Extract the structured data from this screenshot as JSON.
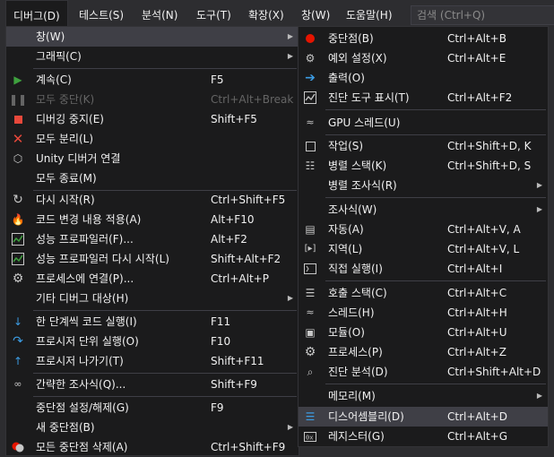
{
  "menubar": {
    "items": [
      "디버그(D)",
      "테스트(S)",
      "분석(N)",
      "도구(T)",
      "확장(X)",
      "창(W)",
      "도움말(H)"
    ],
    "search_placeholder": "검색 (Ctrl+Q)"
  },
  "main_menu": {
    "items": [
      {
        "label": "창(W)",
        "shortcut": "",
        "icon": "none"
      },
      {
        "label": "그래픽(C)",
        "shortcut": "",
        "icon": "none"
      },
      {
        "label": "계속(C)",
        "shortcut": "F5",
        "icon": "play-icon"
      },
      {
        "label": "모두 중단(K)",
        "shortcut": "Ctrl+Alt+Break",
        "icon": "pause-icon"
      },
      {
        "label": "디버깅 중지(E)",
        "shortcut": "Shift+F5",
        "icon": "stop-icon"
      },
      {
        "label": "모두 분리(L)",
        "shortcut": "",
        "icon": "detach-icon"
      },
      {
        "label": "Unity 디버거 연결",
        "shortcut": "",
        "icon": "unity-icon"
      },
      {
        "label": "모두 종료(M)",
        "shortcut": "",
        "icon": "none"
      },
      {
        "label": "다시 시작(R)",
        "shortcut": "Ctrl+Shift+F5",
        "icon": "restart-icon"
      },
      {
        "label": "코드 변경 내용 적용(A)",
        "shortcut": "Alt+F10",
        "icon": "hot-reload-icon"
      },
      {
        "label": "성능 프로파일러(F)...",
        "shortcut": "Alt+F2",
        "icon": "profiler-icon"
      },
      {
        "label": "성능 프로파일러 다시 시작(L)",
        "shortcut": "Shift+Alt+F2",
        "icon": "profiler-restart-icon"
      },
      {
        "label": "프로세스에 연결(P)...",
        "shortcut": "Ctrl+Alt+P",
        "icon": "attach-process-icon"
      },
      {
        "label": "기타 디버그 대상(H)",
        "shortcut": "",
        "icon": "none"
      },
      {
        "label": "한 단계씩 코드 실행(I)",
        "shortcut": "F11",
        "icon": "step-into-icon"
      },
      {
        "label": "프로시저 단위 실행(O)",
        "shortcut": "F10",
        "icon": "step-over-icon"
      },
      {
        "label": "프로시저 나가기(T)",
        "shortcut": "Shift+F11",
        "icon": "step-out-icon"
      },
      {
        "label": "간략한 조사식(Q)...",
        "shortcut": "Shift+F9",
        "icon": "quickwatch-icon"
      },
      {
        "label": "중단점 설정/해제(G)",
        "shortcut": "F9",
        "icon": "none"
      },
      {
        "label": "새 중단점(B)",
        "shortcut": "",
        "icon": "none"
      },
      {
        "label": "모든 중단점 삭제(A)",
        "shortcut": "Ctrl+Shift+F9",
        "icon": "delete-breakpoints-icon"
      }
    ]
  },
  "sub_menu": {
    "items": [
      {
        "label": "중단점(B)",
        "shortcut": "Ctrl+Alt+B",
        "icon": "breakpoint-icon"
      },
      {
        "label": "예외 설정(X)",
        "shortcut": "Ctrl+Alt+E",
        "icon": "exception-settings-icon"
      },
      {
        "label": "출력(O)",
        "shortcut": "",
        "icon": "output-icon"
      },
      {
        "label": "진단 도구 표시(T)",
        "shortcut": "Ctrl+Alt+F2",
        "icon": "diagnostic-tools-icon"
      },
      {
        "label": "GPU 스레드(U)",
        "shortcut": "",
        "icon": "gpu-threads-icon"
      },
      {
        "label": "작업(S)",
        "shortcut": "Ctrl+Shift+D, K",
        "icon": "tasks-icon"
      },
      {
        "label": "병렬 스택(K)",
        "shortcut": "Ctrl+Shift+D, S",
        "icon": "parallel-stacks-icon"
      },
      {
        "label": "병렬 조사식(R)",
        "shortcut": "",
        "icon": "none"
      },
      {
        "label": "조사식(W)",
        "shortcut": "",
        "icon": "none"
      },
      {
        "label": "자동(A)",
        "shortcut": "Ctrl+Alt+V, A",
        "icon": "autos-icon"
      },
      {
        "label": "지역(L)",
        "shortcut": "Ctrl+Alt+V, L",
        "icon": "locals-icon"
      },
      {
        "label": "직접 실행(I)",
        "shortcut": "Ctrl+Alt+I",
        "icon": "immediate-icon"
      },
      {
        "label": "호출 스택(C)",
        "shortcut": "Ctrl+Alt+C",
        "icon": "call-stack-icon"
      },
      {
        "label": "스레드(H)",
        "shortcut": "Ctrl+Alt+H",
        "icon": "threads-icon"
      },
      {
        "label": "모듈(O)",
        "shortcut": "Ctrl+Alt+U",
        "icon": "modules-icon"
      },
      {
        "label": "프로세스(P)",
        "shortcut": "Ctrl+Alt+Z",
        "icon": "processes-icon"
      },
      {
        "label": "진단 분석(D)",
        "shortcut": "Ctrl+Shift+Alt+D",
        "icon": "diagnostic-analysis-icon"
      },
      {
        "label": "메모리(M)",
        "shortcut": "",
        "icon": "none"
      },
      {
        "label": "디스어셈블리(D)",
        "shortcut": "Ctrl+Alt+D",
        "icon": "disassembly-icon"
      },
      {
        "label": "레지스터(G)",
        "shortcut": "Ctrl+Alt+G",
        "icon": "registers-icon"
      }
    ]
  }
}
